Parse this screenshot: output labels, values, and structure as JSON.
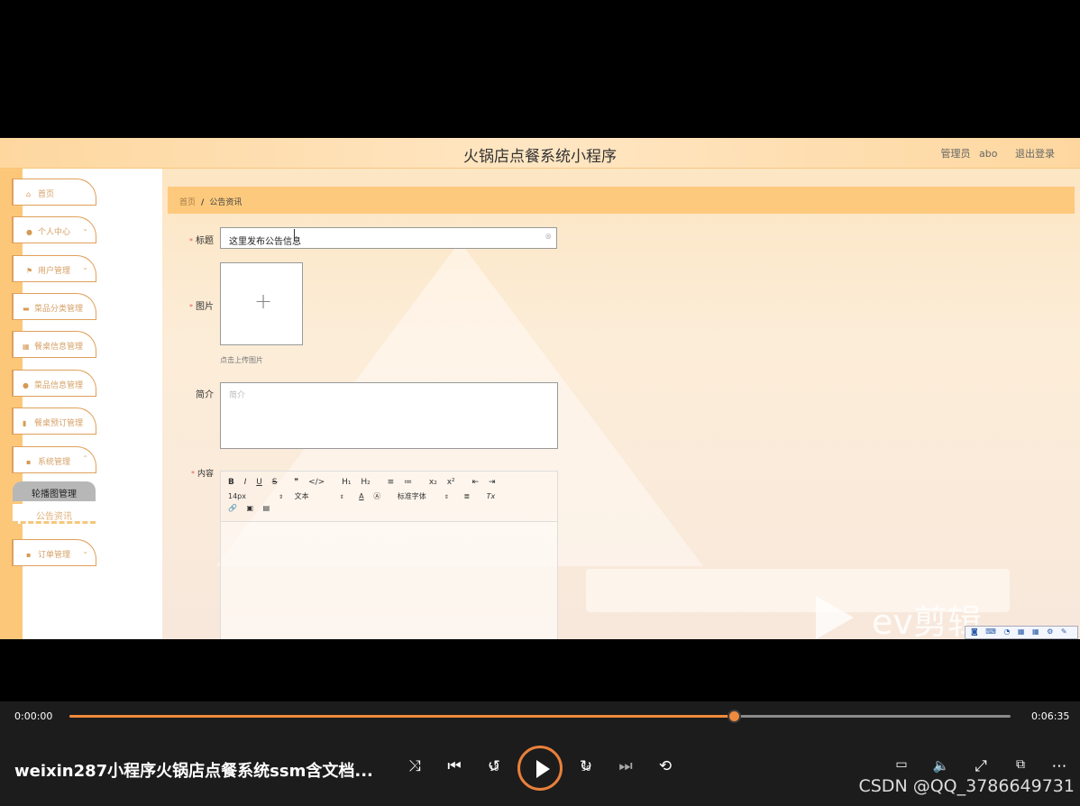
{
  "app": {
    "title": "火锅店点餐系统小程序",
    "role": "管理员",
    "username": "abo",
    "logout": "退出登录"
  },
  "sidebar": {
    "items": [
      {
        "label": "首页",
        "icon": "home-icon"
      },
      {
        "label": "个人中心",
        "icon": "user-icon"
      },
      {
        "label": "用户管理",
        "icon": "flag-icon"
      },
      {
        "label": "菜品分类管理",
        "icon": "list-icon"
      },
      {
        "label": "餐桌信息管理",
        "icon": "grid-icon"
      },
      {
        "label": "菜品信息管理",
        "icon": "location-icon"
      },
      {
        "label": "餐桌预订管理",
        "icon": "bar-chart-icon"
      },
      {
        "label": "系统管理",
        "icon": "apps-icon"
      },
      {
        "label": "订单管理",
        "icon": "apps-icon"
      }
    ],
    "submenu": {
      "active": "轮播图管理",
      "other": "公告资讯"
    }
  },
  "breadcrumb": {
    "home": "首页",
    "separator": "/",
    "current": "公告资讯"
  },
  "form": {
    "title_label": "标题",
    "title_value": "这里发布公告信息",
    "image_label": "图片",
    "upload_hint": "点击上传图片",
    "intro_label": "简介",
    "intro_placeholder": "简介",
    "content_label": "内容"
  },
  "editor": {
    "font_size": "14px",
    "paragraph": "文本",
    "font_family": "标准字体",
    "buttons_row1": [
      "B",
      "I",
      "U",
      "S",
      "❞",
      "</>",
      "H₁",
      "H₂",
      "≡",
      "≔",
      "x₂",
      "x²",
      "⇤",
      "⇥"
    ],
    "buttons_row2": [
      "A",
      "Ⓐ",
      "≣",
      "Tx"
    ],
    "buttons_row3": [
      "🔗",
      "▣",
      "▤"
    ]
  },
  "watermark": {
    "text": "ev剪辑"
  },
  "player": {
    "current_time": "0:00:00",
    "duration": "0:06:35",
    "progress_fraction": 0.706,
    "video_title": "weixin287小程序火锅店点餐系统ssm含文档...",
    "rewind_seconds": "10",
    "forward_seconds": "30",
    "credit": "CSDN @QQ_3786649731",
    "accent_color": "#f08a3c"
  }
}
